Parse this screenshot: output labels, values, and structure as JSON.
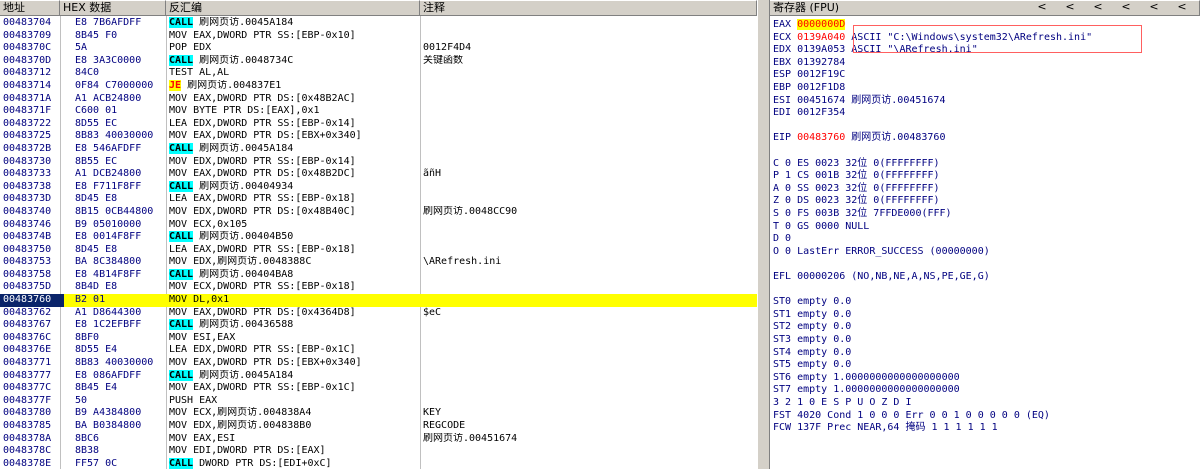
{
  "headers": {
    "addr": "地址",
    "hex": "HEX 数据",
    "dis": "反汇编",
    "cmt": "注释",
    "reg": "寄存器 (FPU)"
  },
  "nav_arrows": [
    "<",
    "<",
    "<",
    "<",
    "<",
    "<"
  ],
  "code_rows": [
    {
      "addr": "00483704",
      "hex": "E8 7B6AFDFF",
      "op": "CALL",
      "rest": " 刷网页访.0045A184",
      "hl": "call",
      "cmt": ""
    },
    {
      "addr": "00483709",
      "hex": "8B45 F0",
      "op": "",
      "rest": "MOV EAX,DWORD PTR SS:[EBP-0x10]",
      "hl": "",
      "cmt": ""
    },
    {
      "addr": "0048370C",
      "hex": "5A",
      "op": "",
      "rest": "POP EDX",
      "hl": "",
      "cmt": "0012F4D4"
    },
    {
      "addr": "0048370D",
      "hex": "E8 3A3C0000",
      "op": "CALL",
      "rest": " 刷网页访.0048734C",
      "hl": "call",
      "cmt": "关键函数"
    },
    {
      "addr": "00483712",
      "hex": "84C0",
      "op": "",
      "rest": "TEST AL,AL",
      "hl": "",
      "cmt": ""
    },
    {
      "addr": "00483714",
      "hex": "0F84 C7000000",
      "op": "JE",
      "rest": " 刷网页访.004837E1",
      "hl": "je",
      "cmt": ""
    },
    {
      "addr": "0048371A",
      "hex": "A1 ACB24800",
      "op": "",
      "rest": "MOV EAX,DWORD PTR DS:[0x48B2AC]",
      "hl": "",
      "cmt": ""
    },
    {
      "addr": "0048371F",
      "hex": "C600 01",
      "op": "",
      "rest": "MOV BYTE PTR DS:[EAX],0x1",
      "hl": "",
      "cmt": ""
    },
    {
      "addr": "00483722",
      "hex": "8D55 EC",
      "op": "",
      "rest": "LEA EDX,DWORD PTR SS:[EBP-0x14]",
      "hl": "",
      "cmt": ""
    },
    {
      "addr": "00483725",
      "hex": "8B83 40030000",
      "op": "",
      "rest": "MOV EAX,DWORD PTR DS:[EBX+0x340]",
      "hl": "",
      "cmt": ""
    },
    {
      "addr": "0048372B",
      "hex": "E8 546AFDFF",
      "op": "CALL",
      "rest": " 刷网页访.0045A184",
      "hl": "call",
      "cmt": ""
    },
    {
      "addr": "00483730",
      "hex": "8B55 EC",
      "op": "",
      "rest": "MOV EDX,DWORD PTR SS:[EBP-0x14]",
      "hl": "",
      "cmt": ""
    },
    {
      "addr": "00483733",
      "hex": "A1 DCB24800",
      "op": "",
      "rest": "MOV EAX,DWORD PTR DS:[0x48B2DC]",
      "hl": "",
      "cmt": "ãñH"
    },
    {
      "addr": "00483738",
      "hex": "E8 F711F8FF",
      "op": "CALL",
      "rest": " 刷网页访.00404934",
      "hl": "call",
      "cmt": ""
    },
    {
      "addr": "0048373D",
      "hex": "8D45 E8",
      "op": "",
      "rest": "LEA EAX,DWORD PTR SS:[EBP-0x18]",
      "hl": "",
      "cmt": ""
    },
    {
      "addr": "00483740",
      "hex": "8B15 0CB44800",
      "op": "",
      "rest": "MOV EDX,DWORD PTR DS:[0x48B40C]",
      "hl": "",
      "cmt": "刷网页访.0048CC90"
    },
    {
      "addr": "00483746",
      "hex": "B9 05010000",
      "op": "",
      "rest": "MOV ECX,0x105",
      "hl": "",
      "cmt": ""
    },
    {
      "addr": "0048374B",
      "hex": "E8 0014F8FF",
      "op": "CALL",
      "rest": " 刷网页访.00404B50",
      "hl": "call",
      "cmt": ""
    },
    {
      "addr": "00483750",
      "hex": "8D45 E8",
      "op": "",
      "rest": "LEA EAX,DWORD PTR SS:[EBP-0x18]",
      "hl": "",
      "cmt": ""
    },
    {
      "addr": "00483753",
      "hex": "BA 8C384800",
      "op": "",
      "rest": "MOV EDX,刷网页访.0048388C",
      "hl": "",
      "cmt": "\\ARefresh.ini"
    },
    {
      "addr": "00483758",
      "hex": "E8 4B14F8FF",
      "op": "CALL",
      "rest": " 刷网页访.00404BA8",
      "hl": "call",
      "cmt": ""
    },
    {
      "addr": "0048375D",
      "hex": "8B4D E8",
      "op": "",
      "rest": "MOV ECX,DWORD PTR SS:[EBP-0x18]",
      "hl": "",
      "cmt": ""
    },
    {
      "addr": "00483760",
      "hex": "B2 01",
      "op": "",
      "rest": "MOV DL,0x1",
      "hl": "",
      "cmt": "",
      "sel": true
    },
    {
      "addr": "00483762",
      "hex": "A1 D8644300",
      "op": "",
      "rest": "MOV EAX,DWORD PTR DS:[0x4364D8]",
      "hl": "",
      "cmt": "$eC"
    },
    {
      "addr": "00483767",
      "hex": "E8 1C2EFBFF",
      "op": "CALL",
      "rest": " 刷网页访.00436588",
      "hl": "call",
      "cmt": ""
    },
    {
      "addr": "0048376C",
      "hex": "8BF0",
      "op": "",
      "rest": "MOV ESI,EAX",
      "hl": "",
      "cmt": ""
    },
    {
      "addr": "0048376E",
      "hex": "8D55 E4",
      "op": "",
      "rest": "LEA EDX,DWORD PTR SS:[EBP-0x1C]",
      "hl": "",
      "cmt": ""
    },
    {
      "addr": "00483771",
      "hex": "8B83 40030000",
      "op": "",
      "rest": "MOV EAX,DWORD PTR DS:[EBX+0x340]",
      "hl": "",
      "cmt": ""
    },
    {
      "addr": "00483777",
      "hex": "E8 086AFDFF",
      "op": "CALL",
      "rest": " 刷网页访.0045A184",
      "hl": "call",
      "cmt": ""
    },
    {
      "addr": "0048377C",
      "hex": "8B45 E4",
      "op": "",
      "rest": "MOV EAX,DWORD PTR SS:[EBP-0x1C]",
      "hl": "",
      "cmt": ""
    },
    {
      "addr": "0048377F",
      "hex": "50",
      "op": "",
      "rest": "PUSH EAX",
      "hl": "",
      "cmt": ""
    },
    {
      "addr": "00483780",
      "hex": "B9 A4384800",
      "op": "",
      "rest": "MOV ECX,刷网页访.004838A4",
      "hl": "",
      "cmt": "KEY"
    },
    {
      "addr": "00483785",
      "hex": "BA B0384800",
      "op": "",
      "rest": "MOV EDX,刷网页访.004838B0",
      "hl": "",
      "cmt": "REGCODE"
    },
    {
      "addr": "0048378A",
      "hex": "8BC6",
      "op": "",
      "rest": "MOV EAX,ESI",
      "hl": "",
      "cmt": "刷网页访.00451674"
    },
    {
      "addr": "0048378C",
      "hex": "8B38",
      "op": "",
      "rest": "MOV EDI,DWORD PTR DS:[EAX]",
      "hl": "",
      "cmt": ""
    },
    {
      "addr": "0048378E",
      "hex": "FF57 0C",
      "op": "CALL",
      "rest": " DWORD PTR DS:[EDI+0xC]",
      "hl": "call",
      "cmt": ""
    }
  ],
  "registers": [
    {
      "text": "EAX ",
      "val": "0000000D",
      "style": "hl",
      "tail": ""
    },
    {
      "text": "ECX ",
      "val": "0139A040",
      "style": "red",
      "tail": " ASCII \"C:\\Windows\\system32\\ARefresh.ini\""
    },
    {
      "text": "EDX ",
      "val": "0139A053",
      "style": "",
      "tail": " ASCII \"\\ARefresh.ini\""
    },
    {
      "text": "EBX ",
      "val": "01392784",
      "style": "",
      "tail": ""
    },
    {
      "text": "ESP ",
      "val": "0012F19C",
      "style": "",
      "tail": ""
    },
    {
      "text": "EBP ",
      "val": "0012F1D8",
      "style": "",
      "tail": ""
    },
    {
      "text": "ESI ",
      "val": "00451674",
      "style": "",
      "tail": " 刷网页访.00451674"
    },
    {
      "text": "EDI ",
      "val": "0012F354",
      "style": "",
      "tail": ""
    },
    {
      "text": "",
      "val": "",
      "style": "",
      "tail": ""
    },
    {
      "text": "EIP ",
      "val": "00483760",
      "style": "red",
      "tail": " 刷网页访.00483760"
    },
    {
      "text": "",
      "val": "",
      "style": "",
      "tail": ""
    },
    {
      "text": "C 0  ES 0023 32位 0(FFFFFFFF)",
      "val": "",
      "style": "",
      "tail": ""
    },
    {
      "text": "P 1  CS 001B 32位 0(FFFFFFFF)",
      "val": "",
      "style": "",
      "tail": ""
    },
    {
      "text": "A 0  SS 0023 32位 0(FFFFFFFF)",
      "val": "",
      "style": "",
      "tail": ""
    },
    {
      "text": "Z 0  DS 0023 32位 0(FFFFFFFF)",
      "val": "",
      "style": "",
      "tail": ""
    },
    {
      "text": "S 0  FS 003B 32位 7FFDE000(FFF)",
      "val": "",
      "style": "",
      "tail": ""
    },
    {
      "text": "T 0  GS 0000 NULL",
      "val": "",
      "style": "",
      "tail": ""
    },
    {
      "text": "D 0",
      "val": "",
      "style": "",
      "tail": ""
    },
    {
      "text": "O 0  LastErr ERROR_SUCCESS (00000000)",
      "val": "",
      "style": "",
      "tail": ""
    },
    {
      "text": "",
      "val": "",
      "style": "",
      "tail": ""
    },
    {
      "text": "EFL 00000206 (NO,NB,NE,A,NS,PE,GE,G)",
      "val": "",
      "style": "",
      "tail": ""
    },
    {
      "text": "",
      "val": "",
      "style": "",
      "tail": ""
    },
    {
      "text": "ST0 empty 0.0",
      "val": "",
      "style": "",
      "tail": ""
    },
    {
      "text": "ST1 empty 0.0",
      "val": "",
      "style": "",
      "tail": ""
    },
    {
      "text": "ST2 empty 0.0",
      "val": "",
      "style": "",
      "tail": ""
    },
    {
      "text": "ST3 empty 0.0",
      "val": "",
      "style": "",
      "tail": ""
    },
    {
      "text": "ST4 empty 0.0",
      "val": "",
      "style": "",
      "tail": ""
    },
    {
      "text": "ST5 empty 0.0",
      "val": "",
      "style": "",
      "tail": ""
    },
    {
      "text": "ST6 empty 1.0000000000000000000",
      "val": "",
      "style": "",
      "tail": ""
    },
    {
      "text": "ST7 empty 1.0000000000000000000",
      "val": "",
      "style": "",
      "tail": ""
    },
    {
      "text": "               3 2 1 0      E S P U O Z D I",
      "val": "",
      "style": "",
      "tail": ""
    },
    {
      "text": "FST 4020  Cond 1 0 0 0  Err 0 0 1 0 0 0 0 0  (EQ)",
      "val": "",
      "style": "",
      "tail": ""
    },
    {
      "text": "FCW 137F  Prec NEAR,64  掩码    1 1 1 1 1 1",
      "val": "",
      "style": "",
      "tail": ""
    }
  ],
  "colors": {
    "selection": "#ffff00",
    "call_bg": "#00ffff",
    "header_bg": "#d4d0c8",
    "address_sel_bg": "#0a246a",
    "red": "#ff0000"
  }
}
